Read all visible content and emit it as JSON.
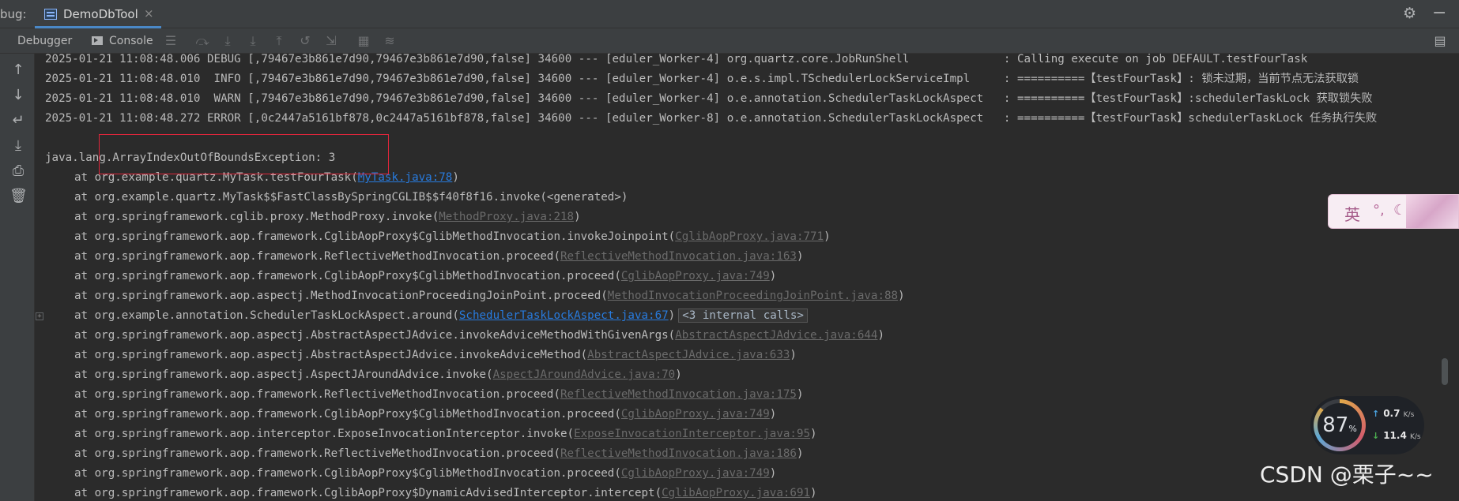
{
  "window": {
    "prefix": "bug:",
    "tab_label": "DemoDbTool",
    "tab_close": "×"
  },
  "toolbar": {
    "debugger_label": "Debugger",
    "console_label": "Console"
  },
  "log_lines": [
    "2025-01-21 11:08:48.006 DEBUG [,79467e3b861e7d90,79467e3b861e7d90,false] 34600 --- [eduler_Worker-4] org.quartz.core.JobRunShell              : Calling execute on job DEFAULT.testFourTask",
    "2025-01-21 11:08:48.010  INFO [,79467e3b861e7d90,79467e3b861e7d90,false] 34600 --- [eduler_Worker-4] o.e.s.impl.TSchedulerLockServiceImpl     : ==========【testFourTask】: 锁未过期，当前节点无法获取锁",
    "2025-01-21 11:08:48.010  WARN [,79467e3b861e7d90,79467e3b861e7d90,false] 34600 --- [eduler_Worker-4] o.e.annotation.SchedulerTaskLockAspect   : ==========【testFourTask】:schedulerTaskLock 获取锁失败",
    "2025-01-21 11:08:48.272 ERROR [,0c2447a5161bf878,0c2447a5161bf878,false] 34600 --- [eduler_Worker-8] o.e.annotation.SchedulerTaskLockAspect   : ==========【testFourTask】schedulerTaskLock 任务执行失败"
  ],
  "exception": "java.lang.ArrayIndexOutOfBoundsException: 3",
  "stack": [
    {
      "text": "at org.example.quartz.MyTask.testFourTask(",
      "link": "MyTask.java:78",
      "suffix": ")",
      "dim": false
    },
    {
      "text": "at org.example.quartz.MyTask$$FastClassBySpringCGLIB$$f40f8f16.invoke(<generated>)",
      "link": "",
      "suffix": "",
      "dim": true
    },
    {
      "text": "at org.springframework.cglib.proxy.MethodProxy.invoke(",
      "link": "MethodProxy.java:218",
      "suffix": ")",
      "dim": true
    },
    {
      "text": "at org.springframework.aop.framework.CglibAopProxy$CglibMethodInvocation.invokeJoinpoint(",
      "link": "CglibAopProxy.java:771",
      "suffix": ")",
      "dim": true
    },
    {
      "text": "at org.springframework.aop.framework.ReflectiveMethodInvocation.proceed(",
      "link": "ReflectiveMethodInvocation.java:163",
      "suffix": ")",
      "dim": true
    },
    {
      "text": "at org.springframework.aop.framework.CglibAopProxy$CglibMethodInvocation.proceed(",
      "link": "CglibAopProxy.java:749",
      "suffix": ")",
      "dim": true
    },
    {
      "text": "at org.springframework.aop.aspectj.MethodInvocationProceedingJoinPoint.proceed(",
      "link": "MethodInvocationProceedingJoinPoint.java:88",
      "suffix": ")",
      "dim": true
    },
    {
      "text": "at org.example.annotation.SchedulerTaskLockAspect.around(",
      "link": "SchedulerTaskLockAspect.java:67",
      "suffix": ")",
      "dim": false,
      "folded": "<3 internal calls>"
    },
    {
      "text": "at org.springframework.aop.aspectj.AbstractAspectJAdvice.invokeAdviceMethodWithGivenArgs(",
      "link": "AbstractAspectJAdvice.java:644",
      "suffix": ")",
      "dim": true
    },
    {
      "text": "at org.springframework.aop.aspectj.AbstractAspectJAdvice.invokeAdviceMethod(",
      "link": "AbstractAspectJAdvice.java:633",
      "suffix": ")",
      "dim": true
    },
    {
      "text": "at org.springframework.aop.aspectj.AspectJAroundAdvice.invoke(",
      "link": "AspectJAroundAdvice.java:70",
      "suffix": ")",
      "dim": true
    },
    {
      "text": "at org.springframework.aop.framework.ReflectiveMethodInvocation.proceed(",
      "link": "ReflectiveMethodInvocation.java:175",
      "suffix": ")",
      "dim": true
    },
    {
      "text": "at org.springframework.aop.framework.CglibAopProxy$CglibMethodInvocation.proceed(",
      "link": "CglibAopProxy.java:749",
      "suffix": ")",
      "dim": true
    },
    {
      "text": "at org.springframework.aop.interceptor.ExposeInvocationInterceptor.invoke(",
      "link": "ExposeInvocationInterceptor.java:95",
      "suffix": ")",
      "dim": true
    },
    {
      "text": "at org.springframework.aop.framework.ReflectiveMethodInvocation.proceed(",
      "link": "ReflectiveMethodInvocation.java:186",
      "suffix": ")",
      "dim": true
    },
    {
      "text": "at org.springframework.aop.framework.CglibAopProxy$CglibMethodInvocation.proceed(",
      "link": "CglibAopProxy.java:749",
      "suffix": ")",
      "dim": true
    },
    {
      "text": "at org.springframework.aop.framework.CglibAopProxy$DynamicAdvisedInterceptor.intercept(",
      "link": "CglibAopProxy.java:691",
      "suffix": ")",
      "dim": true
    }
  ],
  "ime": {
    "lang": "英"
  },
  "net_widget": {
    "gauge_value": "87",
    "gauge_unit": "%",
    "up_speed": "0.7",
    "down_speed": "11.4",
    "speed_unit": "K/s"
  },
  "watermark": "CSDN @栗子~~"
}
